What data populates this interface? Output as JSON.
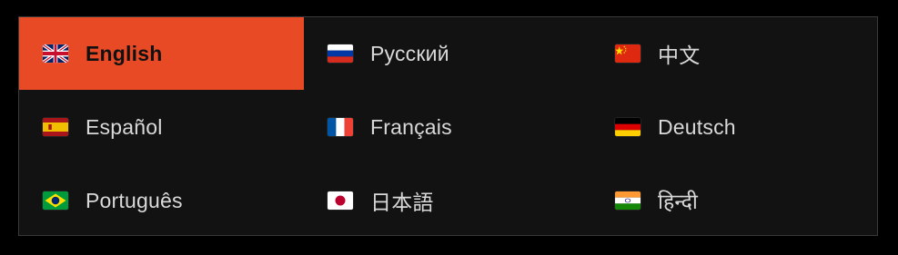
{
  "languages": [
    {
      "label": "English",
      "flag": "uk-flag-icon",
      "active": true
    },
    {
      "label": "Русский",
      "flag": "russia-flag-icon",
      "active": false
    },
    {
      "label": "中文",
      "flag": "china-flag-icon",
      "active": false
    },
    {
      "label": "Español",
      "flag": "spain-flag-icon",
      "active": false
    },
    {
      "label": "Français",
      "flag": "france-flag-icon",
      "active": false
    },
    {
      "label": "Deutsch",
      "flag": "germany-flag-icon",
      "active": false
    },
    {
      "label": "Português",
      "flag": "brazil-flag-icon",
      "active": false
    },
    {
      "label": "日本語",
      "flag": "japan-flag-icon",
      "active": false
    },
    {
      "label": "हिन्दी",
      "flag": "india-flag-icon",
      "active": false
    }
  ],
  "colors": {
    "accent": "#e84a26",
    "background": "#121212",
    "text": "#d9d9d9"
  }
}
